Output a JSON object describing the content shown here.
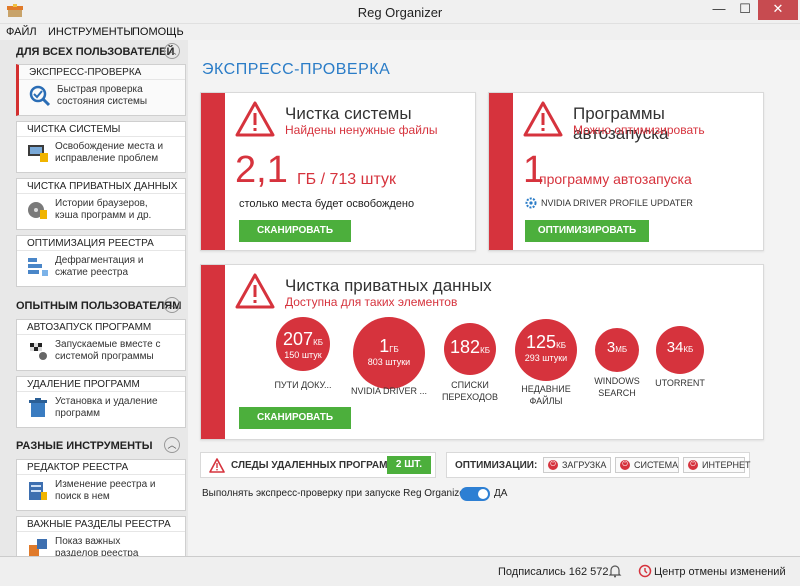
{
  "window": {
    "title": "Reg Organizer",
    "min": "—",
    "max": "☐",
    "close": "✕"
  },
  "menu": [
    "ФАЙЛ",
    "ИНСТРУМЕНТЫ",
    "ПОМОЩЬ"
  ],
  "sidebar": {
    "groups": [
      {
        "label": "ДЛЯ ВСЕХ ПОЛЬЗОВАТЕЛЕЙ"
      },
      {
        "label": "ОПЫТНЫМ ПОЛЬЗОВАТЕЛЯМ"
      },
      {
        "label": "РАЗНЫЕ ИНСТРУМЕНТЫ"
      }
    ],
    "items": [
      {
        "title": "ЭКСПРЕСС-ПРОВЕРКА",
        "desc1": "Быстрая проверка",
        "desc2": "состояния системы"
      },
      {
        "title": "ЧИСТКА СИСТЕМЫ",
        "desc1": "Освобождение места и",
        "desc2": "исправление проблем"
      },
      {
        "title": "ЧИСТКА ПРИВАТНЫХ ДАННЫХ",
        "desc1": "Истории браузеров,",
        "desc2": "кэша программ и др."
      },
      {
        "title": "ОПТИМИЗАЦИЯ РЕЕСТРА",
        "desc1": "Дефрагментация и",
        "desc2": "сжатие реестра"
      },
      {
        "title": "АВТОЗАПУСК ПРОГРАММ",
        "desc1": "Запускаемые вместе с",
        "desc2": "системой программы"
      },
      {
        "title": "УДАЛЕНИЕ ПРОГРАММ",
        "desc1": "Установка и удаление",
        "desc2": "программ"
      },
      {
        "title": "РЕДАКТОР РЕЕСТРА",
        "desc1": "Изменение реестра и",
        "desc2": "поиск в нем"
      },
      {
        "title": "ВАЖНЫЕ РАЗДЕЛЫ РЕЕСТРА",
        "desc1": "Показ важных",
        "desc2": "разделов реестра"
      }
    ]
  },
  "main": {
    "title": "ЭКСПРЕСС-ПРОВЕРКА",
    "cleanup": {
      "title": "Чистка системы",
      "subtitle": "Найдены ненужные файлы",
      "value": "2,1",
      "unit": "ГБ / 713 штук",
      "note": "столько места будет освобождено",
      "button": "СКАНИРОВАТЬ"
    },
    "autorun": {
      "title": "Программы автозапуска",
      "subtitle": "Можно оптимизировать",
      "value": "1",
      "unit": "программу автозапуска",
      "app": "NVIDIA DRIVER PROFILE UPDATER",
      "button": "ОПТИМИЗИРОВАТЬ"
    },
    "private": {
      "title": "Чистка приватных данных",
      "subtitle": "Доступна для таких элементов",
      "button": "СКАНИРОВАТЬ",
      "items": [
        {
          "value": "207",
          "unit": "КБ",
          "count": "150 штук",
          "label1": "ПУТИ ДОКУ...",
          "label2": ""
        },
        {
          "value": "1",
          "unit": "ГБ",
          "count": "803 штуки",
          "label1": "NVIDIA DRIVER ...",
          "label2": ""
        },
        {
          "value": "182",
          "unit": "КБ",
          "count": "",
          "label1": "СПИСКИ",
          "label2": "ПЕРЕХОДОВ"
        },
        {
          "value": "125",
          "unit": "КБ",
          "count": "293 штуки",
          "label1": "НЕДАВНИЕ",
          "label2": "ФАЙЛЫ"
        },
        {
          "value": "3",
          "unit": "МБ",
          "count": "",
          "label1": "WINDOWS",
          "label2": "SEARCH"
        },
        {
          "value": "34",
          "unit": "КБ",
          "count": "",
          "label1": "UTORRENT",
          "label2": ""
        }
      ]
    },
    "traces": {
      "label": "СЛЕДЫ УДАЛЕННЫХ ПРОГРАММ",
      "count": "2 ШТ."
    },
    "optimizations": {
      "label": "ОПТИМИЗАЦИИ:",
      "buttons": [
        "ЗАГРУЗКА",
        "СИСТЕМА",
        "ИНТЕРНЕТ"
      ]
    },
    "startup": {
      "label": "Выполнять экспресс-проверку при запуске Reg Organizer",
      "state": "ДА"
    }
  },
  "status": {
    "subscribed": "Подписались 162 572",
    "undo": "Центр отмены изменений"
  },
  "colors": {
    "accent": "#d6333d",
    "green": "#4caf3c",
    "blue": "#2a7cc7"
  }
}
